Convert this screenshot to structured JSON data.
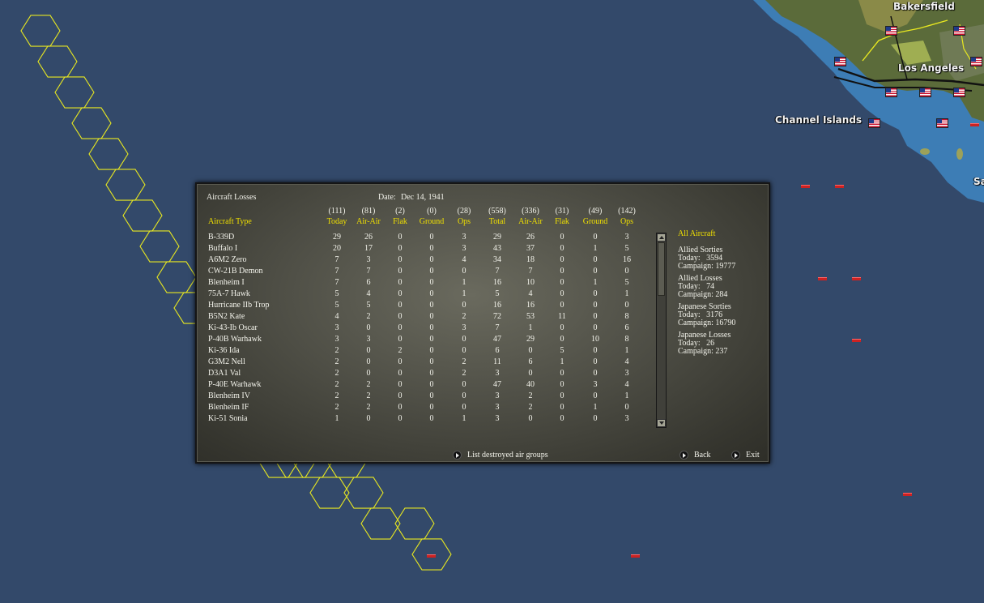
{
  "map": {
    "labels": [
      {
        "name": "label-bakersfield",
        "text": "Bakersfield"
      },
      {
        "name": "label-los-angeles",
        "text": "Los Angeles"
      },
      {
        "name": "label-channel-islands",
        "text": "Channel Islands"
      },
      {
        "name": "label-san",
        "text": "Sa"
      }
    ],
    "colors": {
      "ocean": "#33496a",
      "coast_water": "#3d7db5",
      "land": "#5b6b3a",
      "hex_outline": "#e8e820"
    }
  },
  "panel": {
    "title": "Aircraft Losses",
    "date_label": "Date:",
    "date_value": "Dec 14, 1941",
    "column_name_header": "Aircraft Type",
    "column_totals": [
      "(111)",
      "(81)",
      "(2)",
      "(0)",
      "(28)",
      "(558)",
      "(336)",
      "(31)",
      "(49)",
      "(142)"
    ],
    "column_headers": [
      "Today",
      "Air-Air",
      "Flak",
      "Ground",
      "Ops",
      "Total",
      "Air-Air",
      "Flak",
      "Ground",
      "Ops"
    ],
    "rows": [
      {
        "name": "B-339D",
        "values": [
          "29",
          "26",
          "0",
          "0",
          "3",
          "29",
          "26",
          "0",
          "0",
          "3"
        ]
      },
      {
        "name": "Buffalo I",
        "values": [
          "20",
          "17",
          "0",
          "0",
          "3",
          "43",
          "37",
          "0",
          "1",
          "5"
        ]
      },
      {
        "name": "A6M2 Zero",
        "values": [
          "7",
          "3",
          "0",
          "0",
          "4",
          "34",
          "18",
          "0",
          "0",
          "16"
        ]
      },
      {
        "name": "CW-21B Demon",
        "values": [
          "7",
          "7",
          "0",
          "0",
          "0",
          "7",
          "7",
          "0",
          "0",
          "0"
        ]
      },
      {
        "name": "Blenheim I",
        "values": [
          "7",
          "6",
          "0",
          "0",
          "1",
          "16",
          "10",
          "0",
          "1",
          "5"
        ]
      },
      {
        "name": "75A-7 Hawk",
        "values": [
          "5",
          "4",
          "0",
          "0",
          "1",
          "5",
          "4",
          "0",
          "0",
          "1"
        ]
      },
      {
        "name": "Hurricane IIb Trop",
        "values": [
          "5",
          "5",
          "0",
          "0",
          "0",
          "16",
          "16",
          "0",
          "0",
          "0"
        ]
      },
      {
        "name": "B5N2 Kate",
        "values": [
          "4",
          "2",
          "0",
          "0",
          "2",
          "72",
          "53",
          "11",
          "0",
          "8"
        ]
      },
      {
        "name": "Ki-43-Ib Oscar",
        "values": [
          "3",
          "0",
          "0",
          "0",
          "3",
          "7",
          "1",
          "0",
          "0",
          "6"
        ]
      },
      {
        "name": "P-40B Warhawk",
        "values": [
          "3",
          "3",
          "0",
          "0",
          "0",
          "47",
          "29",
          "0",
          "10",
          "8"
        ]
      },
      {
        "name": "Ki-36 Ida",
        "values": [
          "2",
          "0",
          "2",
          "0",
          "0",
          "6",
          "0",
          "5",
          "0",
          "1"
        ]
      },
      {
        "name": "G3M2 Nell",
        "values": [
          "2",
          "0",
          "0",
          "0",
          "2",
          "11",
          "6",
          "1",
          "0",
          "4"
        ]
      },
      {
        "name": "D3A1 Val",
        "values": [
          "2",
          "0",
          "0",
          "0",
          "2",
          "3",
          "0",
          "0",
          "0",
          "3"
        ]
      },
      {
        "name": "P-40E Warhawk",
        "values": [
          "2",
          "2",
          "0",
          "0",
          "0",
          "47",
          "40",
          "0",
          "3",
          "4"
        ]
      },
      {
        "name": "Blenheim IV",
        "values": [
          "2",
          "2",
          "0",
          "0",
          "0",
          "3",
          "2",
          "0",
          "0",
          "1"
        ]
      },
      {
        "name": "Blenheim IF",
        "values": [
          "2",
          "2",
          "0",
          "0",
          "0",
          "3",
          "2",
          "0",
          "1",
          "0"
        ]
      },
      {
        "name": "Ki-51 Sonia",
        "values": [
          "1",
          "0",
          "0",
          "0",
          "1",
          "3",
          "0",
          "0",
          "0",
          "3"
        ]
      }
    ],
    "summary": {
      "filter": "All Aircraft",
      "blocks": [
        {
          "title": "Allied Sorties",
          "today": "Today:   3594",
          "campaign": "Campaign: 19777"
        },
        {
          "title": "Allied Losses",
          "today": "Today:   74",
          "campaign": "Campaign: 284"
        },
        {
          "title": "Japanese Sorties",
          "today": "Today:   3176",
          "campaign": "Campaign: 16790"
        },
        {
          "title": "Japanese Losses",
          "today": "Today:   26",
          "campaign": "Campaign: 237"
        }
      ]
    },
    "buttons": {
      "list_destroyed": "List destroyed air groups",
      "back": "Back",
      "exit": "Exit"
    }
  }
}
